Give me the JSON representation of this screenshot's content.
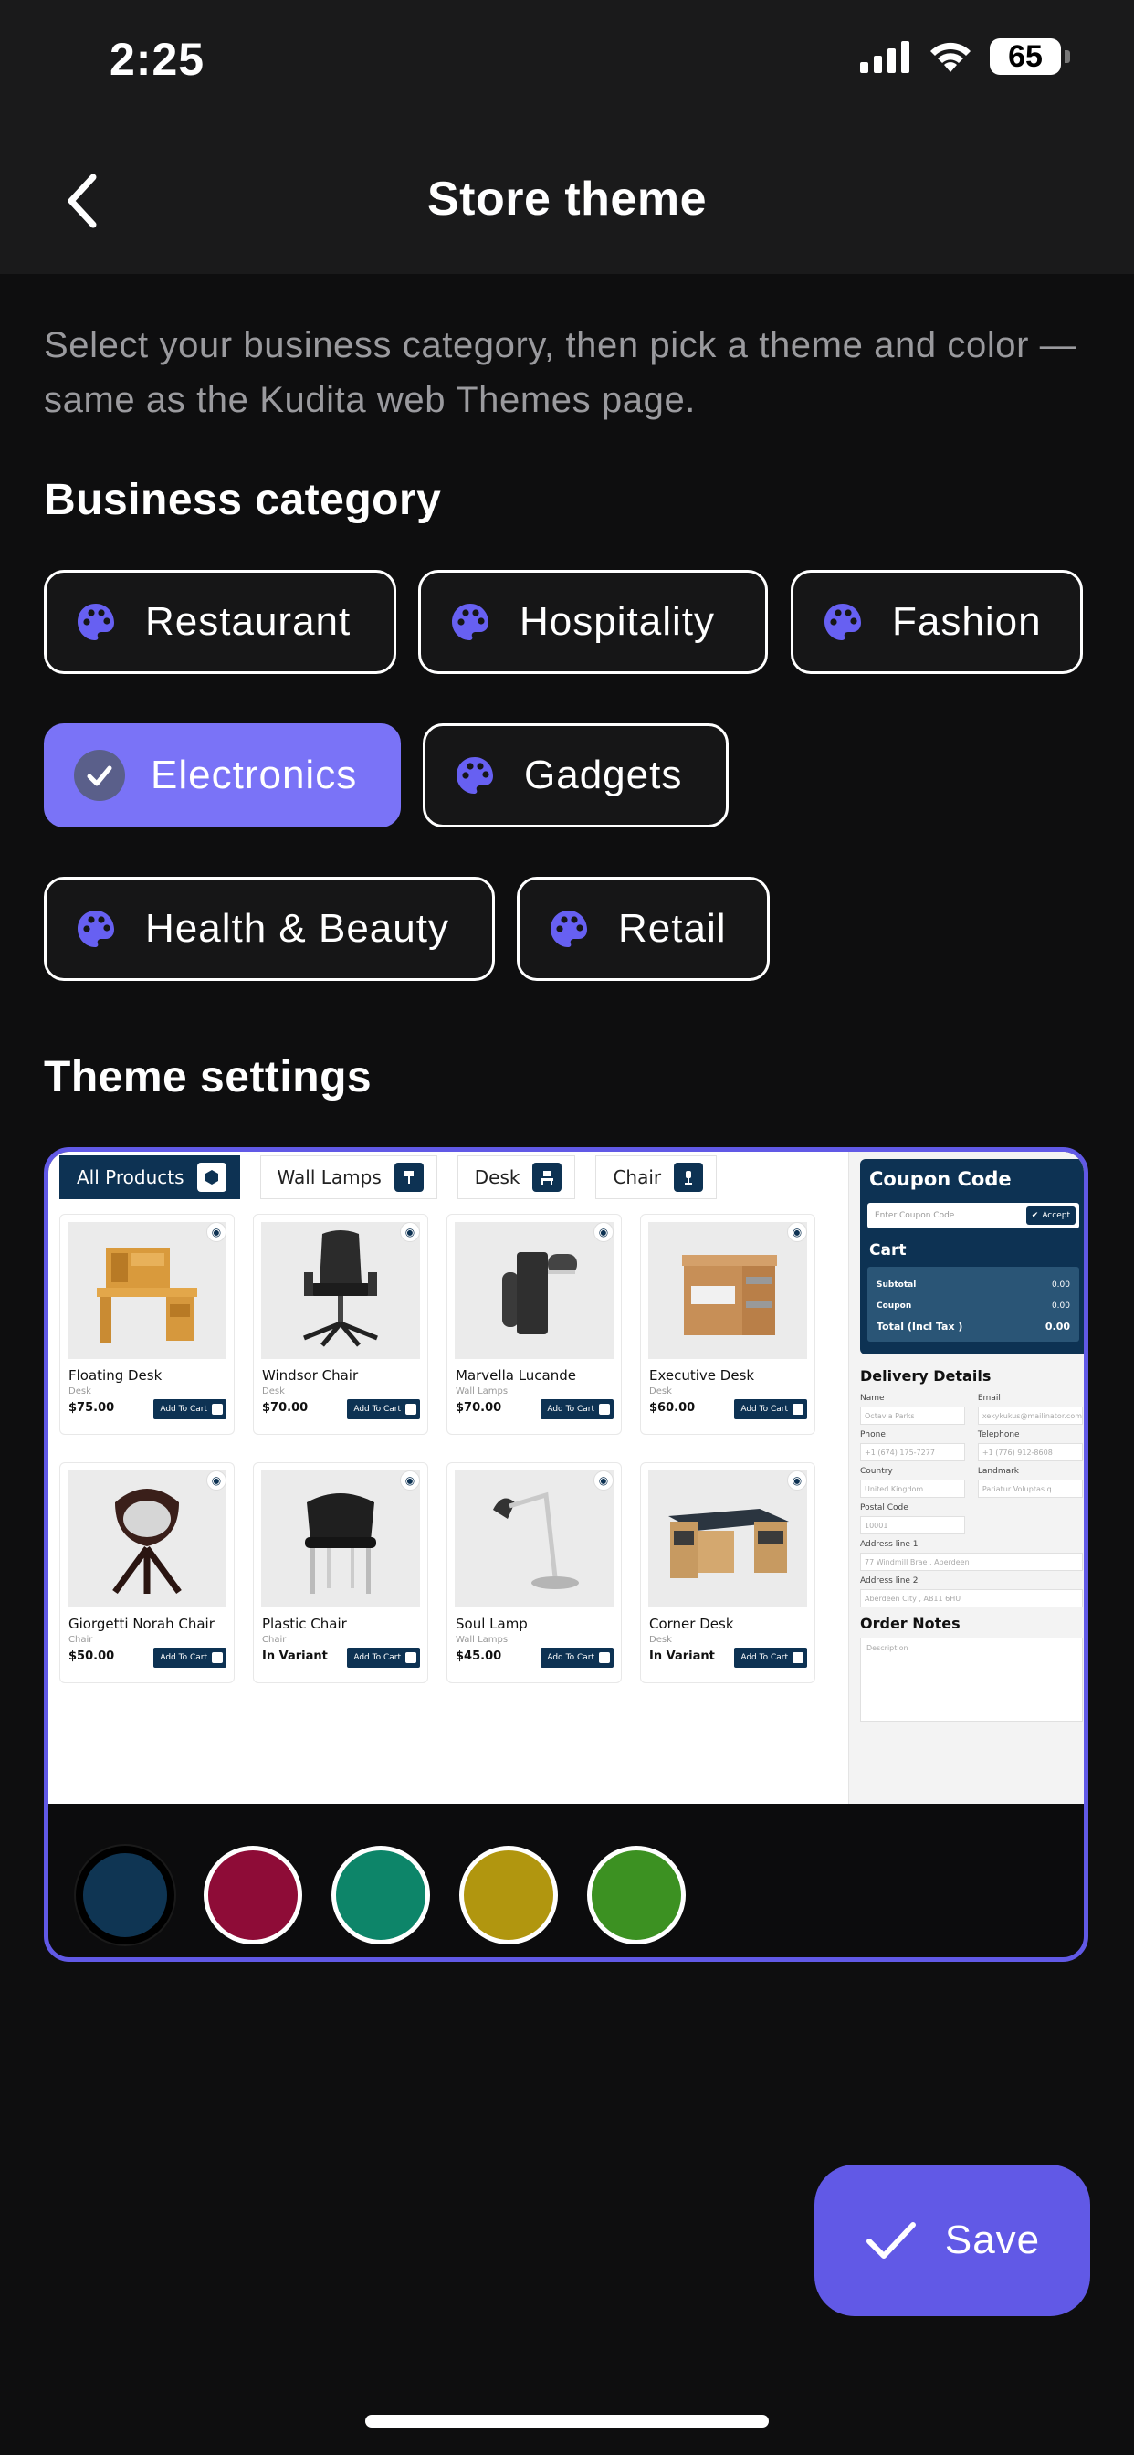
{
  "status_bar": {
    "time": "2:25",
    "battery": "65"
  },
  "header": {
    "title": "Store theme"
  },
  "intro": "Select your business category, then pick a theme and color — same as the Kudita web Themes page.",
  "business_category": {
    "title": "Business category",
    "selected": "Electronics",
    "options": [
      {
        "label": "Restaurant"
      },
      {
        "label": "Hospitality"
      },
      {
        "label": "Fashion"
      },
      {
        "label": "Electronics"
      },
      {
        "label": "Gadgets"
      },
      {
        "label": "Health & Beauty"
      },
      {
        "label": "Retail"
      }
    ]
  },
  "theme_settings": {
    "title": "Theme settings",
    "preview": {
      "tabs": [
        "All Products",
        "Wall Lamps",
        "Desk",
        "Chair"
      ],
      "products": [
        {
          "name": "Floating Desk",
          "category": "Desk",
          "price": "$75.00",
          "image": "desk-image"
        },
        {
          "name": "Windsor Chair",
          "category": "Desk",
          "price": "$70.00",
          "image": "office-chair-image"
        },
        {
          "name": "Marvella Lucande",
          "category": "Wall Lamps",
          "price": "$70.00",
          "image": "wall-lamp-image"
        },
        {
          "name": "Executive Desk",
          "category": "Desk",
          "price": "$60.00",
          "image": "drawer-desk-image"
        },
        {
          "name": "Giorgetti Norah Chair",
          "category": "Chair",
          "price": "$50.00",
          "image": "lounge-chair-image"
        },
        {
          "name": "Plastic Chair",
          "category": "Chair",
          "price": "In Variant",
          "image": "plastic-chair-image"
        },
        {
          "name": "Soul Lamp",
          "category": "Wall Lamps",
          "price": "$45.00",
          "image": "desk-lamp-image"
        },
        {
          "name": "Corner Desk",
          "category": "Desk",
          "price": "In Variant",
          "image": "corner-desk-image"
        }
      ],
      "add_to_cart": "Add To Cart",
      "coupon": {
        "title": "Coupon Code",
        "placeholder": "Enter Coupon Code",
        "accept": "Accept"
      },
      "cart": {
        "title": "Cart",
        "rows": [
          {
            "label": "Subtotal",
            "value": "0.00"
          },
          {
            "label": "Coupon",
            "value": "0.00"
          },
          {
            "label": "Total (Incl Tax )",
            "value": "0.00"
          }
        ]
      },
      "delivery": {
        "title": "Delivery Details",
        "fields": [
          {
            "label": "Name",
            "placeholder": "Octavia Parks"
          },
          {
            "label": "Email",
            "placeholder": "xekykukus@mailinator.com"
          },
          {
            "label": "Phone",
            "placeholder": "+1 (674) 175-7277"
          },
          {
            "label": "Telephone",
            "placeholder": "+1 (776) 912-8608"
          },
          {
            "label": "Country",
            "placeholder": "United Kingdom"
          },
          {
            "label": "Landmark",
            "placeholder": "Pariatur Voluptas q"
          }
        ],
        "postal_code": {
          "label": "Postal Code",
          "placeholder": "10001"
        },
        "address1": {
          "label": "Address line 1",
          "placeholder": "77 Windmill Brae , Aberdeen"
        },
        "address2": {
          "label": "Address line 2",
          "placeholder": "Aberdeen City , AB11 6HU"
        }
      },
      "order_notes": {
        "title": "Order Notes",
        "placeholder": "Description"
      }
    },
    "colors": [
      "#0f3553",
      "#8e0c37",
      "#0d8569",
      "#b1960f",
      "#3c9122"
    ],
    "selected_color": "#0f3553"
  },
  "save_label": "Save",
  "accent_color": "#6159e6",
  "selected_chip_color": "#7a73f7"
}
